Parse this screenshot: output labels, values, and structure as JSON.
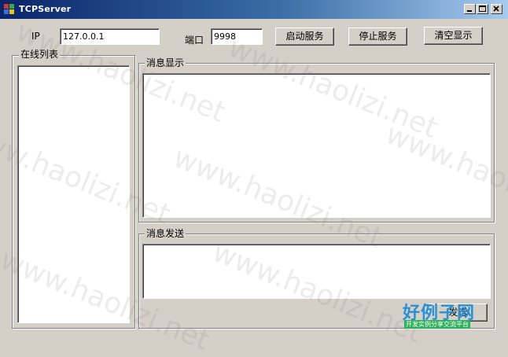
{
  "window": {
    "title": "TCPServer",
    "icon": "app-icon",
    "controls": [
      "minimize-icon",
      "maximize-icon",
      "close-icon"
    ]
  },
  "top_bar": {
    "ip_label": "IP",
    "ip_value": "127.0.0.1",
    "port_label": "端口",
    "port_value": "9998",
    "start_button": "启动服务",
    "stop_button": "停止服务",
    "clear_button": "清空显示"
  },
  "online_list": {
    "legend": "在线列表",
    "items": []
  },
  "message_display": {
    "legend": "消息显示",
    "content": ""
  },
  "message_send": {
    "legend": "消息发送",
    "content": "",
    "send_button": "发送"
  },
  "watermark": "www.haolizi.net",
  "logo": {
    "title": "好例子网",
    "subtitle": "开发实例分享交流平台"
  }
}
